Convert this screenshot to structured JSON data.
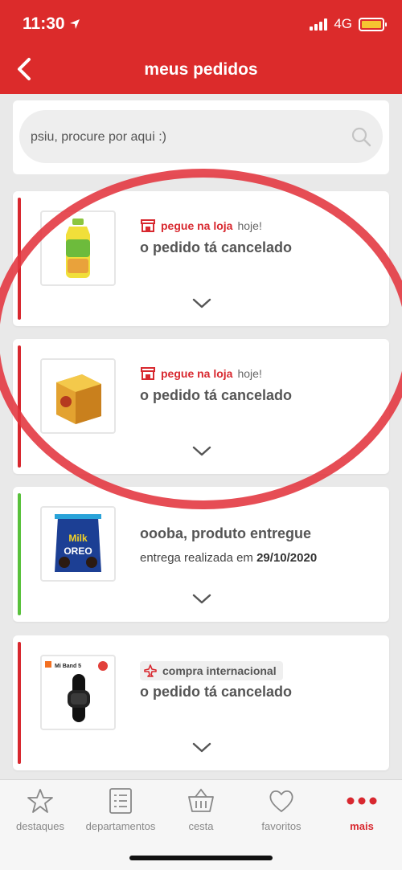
{
  "status_bar": {
    "time": "11:30",
    "network": "4G"
  },
  "header": {
    "title": "meus pedidos"
  },
  "search": {
    "text": "psiu, procure por aqui :)"
  },
  "orders": [
    {
      "tag_label": "pegue na loja",
      "tag_suffix": "hoje!",
      "status": "o pedido tá cancelado",
      "accent": "#d8282f"
    },
    {
      "tag_label": "pegue na loja",
      "tag_suffix": "hoje!",
      "status": "o pedido tá cancelado",
      "accent": "#d8282f"
    },
    {
      "status": "oooba, produto entregue",
      "detail_label": "entrega realizada em",
      "detail_value": "29/10/2020",
      "accent": "#59c13c",
      "thumb_text": [
        "Milk",
        "OREO"
      ]
    },
    {
      "tag_label": "compra internacional",
      "status": "o pedido tá cancelado",
      "accent": "#d8282f",
      "thumb_text": "Mi Band 5"
    }
  ],
  "tabbar": {
    "items": [
      {
        "label": "destaques",
        "icon": "star-icon",
        "active": false
      },
      {
        "label": "departamentos",
        "icon": "list-icon",
        "active": false
      },
      {
        "label": "cesta",
        "icon": "basket-icon",
        "active": false
      },
      {
        "label": "favoritos",
        "icon": "heart-icon",
        "active": false
      },
      {
        "label": "mais",
        "icon": "more-dots-icon",
        "active": true
      }
    ]
  },
  "colors": {
    "brand": "#dc2b2b",
    "accent_red": "#d8282f",
    "delivered_green": "#59c13c"
  }
}
